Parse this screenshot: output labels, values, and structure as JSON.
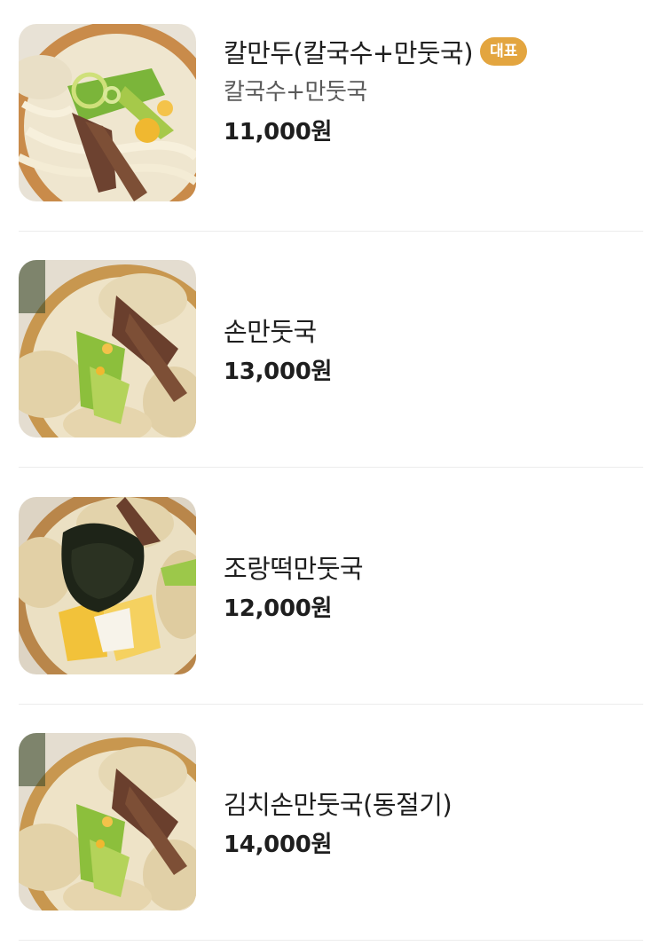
{
  "menu": {
    "items": [
      {
        "name": "칼만두(칼국수+만둣국)",
        "badge": "대표",
        "description": "칼국수+만둣국",
        "price": "11,000원",
        "photo": "noodle-dumpling-soup-photo"
      },
      {
        "name": "손만둣국",
        "price": "13,000원",
        "photo": "dumpling-soup-photo"
      },
      {
        "name": "조랑떡만둣국",
        "price": "12,000원",
        "photo": "rice-cake-dumpling-soup-photo"
      },
      {
        "name": "김치손만둣국(동절기)",
        "price": "14,000원",
        "photo": "kimchi-dumpling-soup-photo"
      }
    ]
  },
  "colors": {
    "badge": "#e3a53f",
    "text": "#1e1e1e",
    "subtext": "#5a5a5a",
    "divider": "#ececec"
  }
}
